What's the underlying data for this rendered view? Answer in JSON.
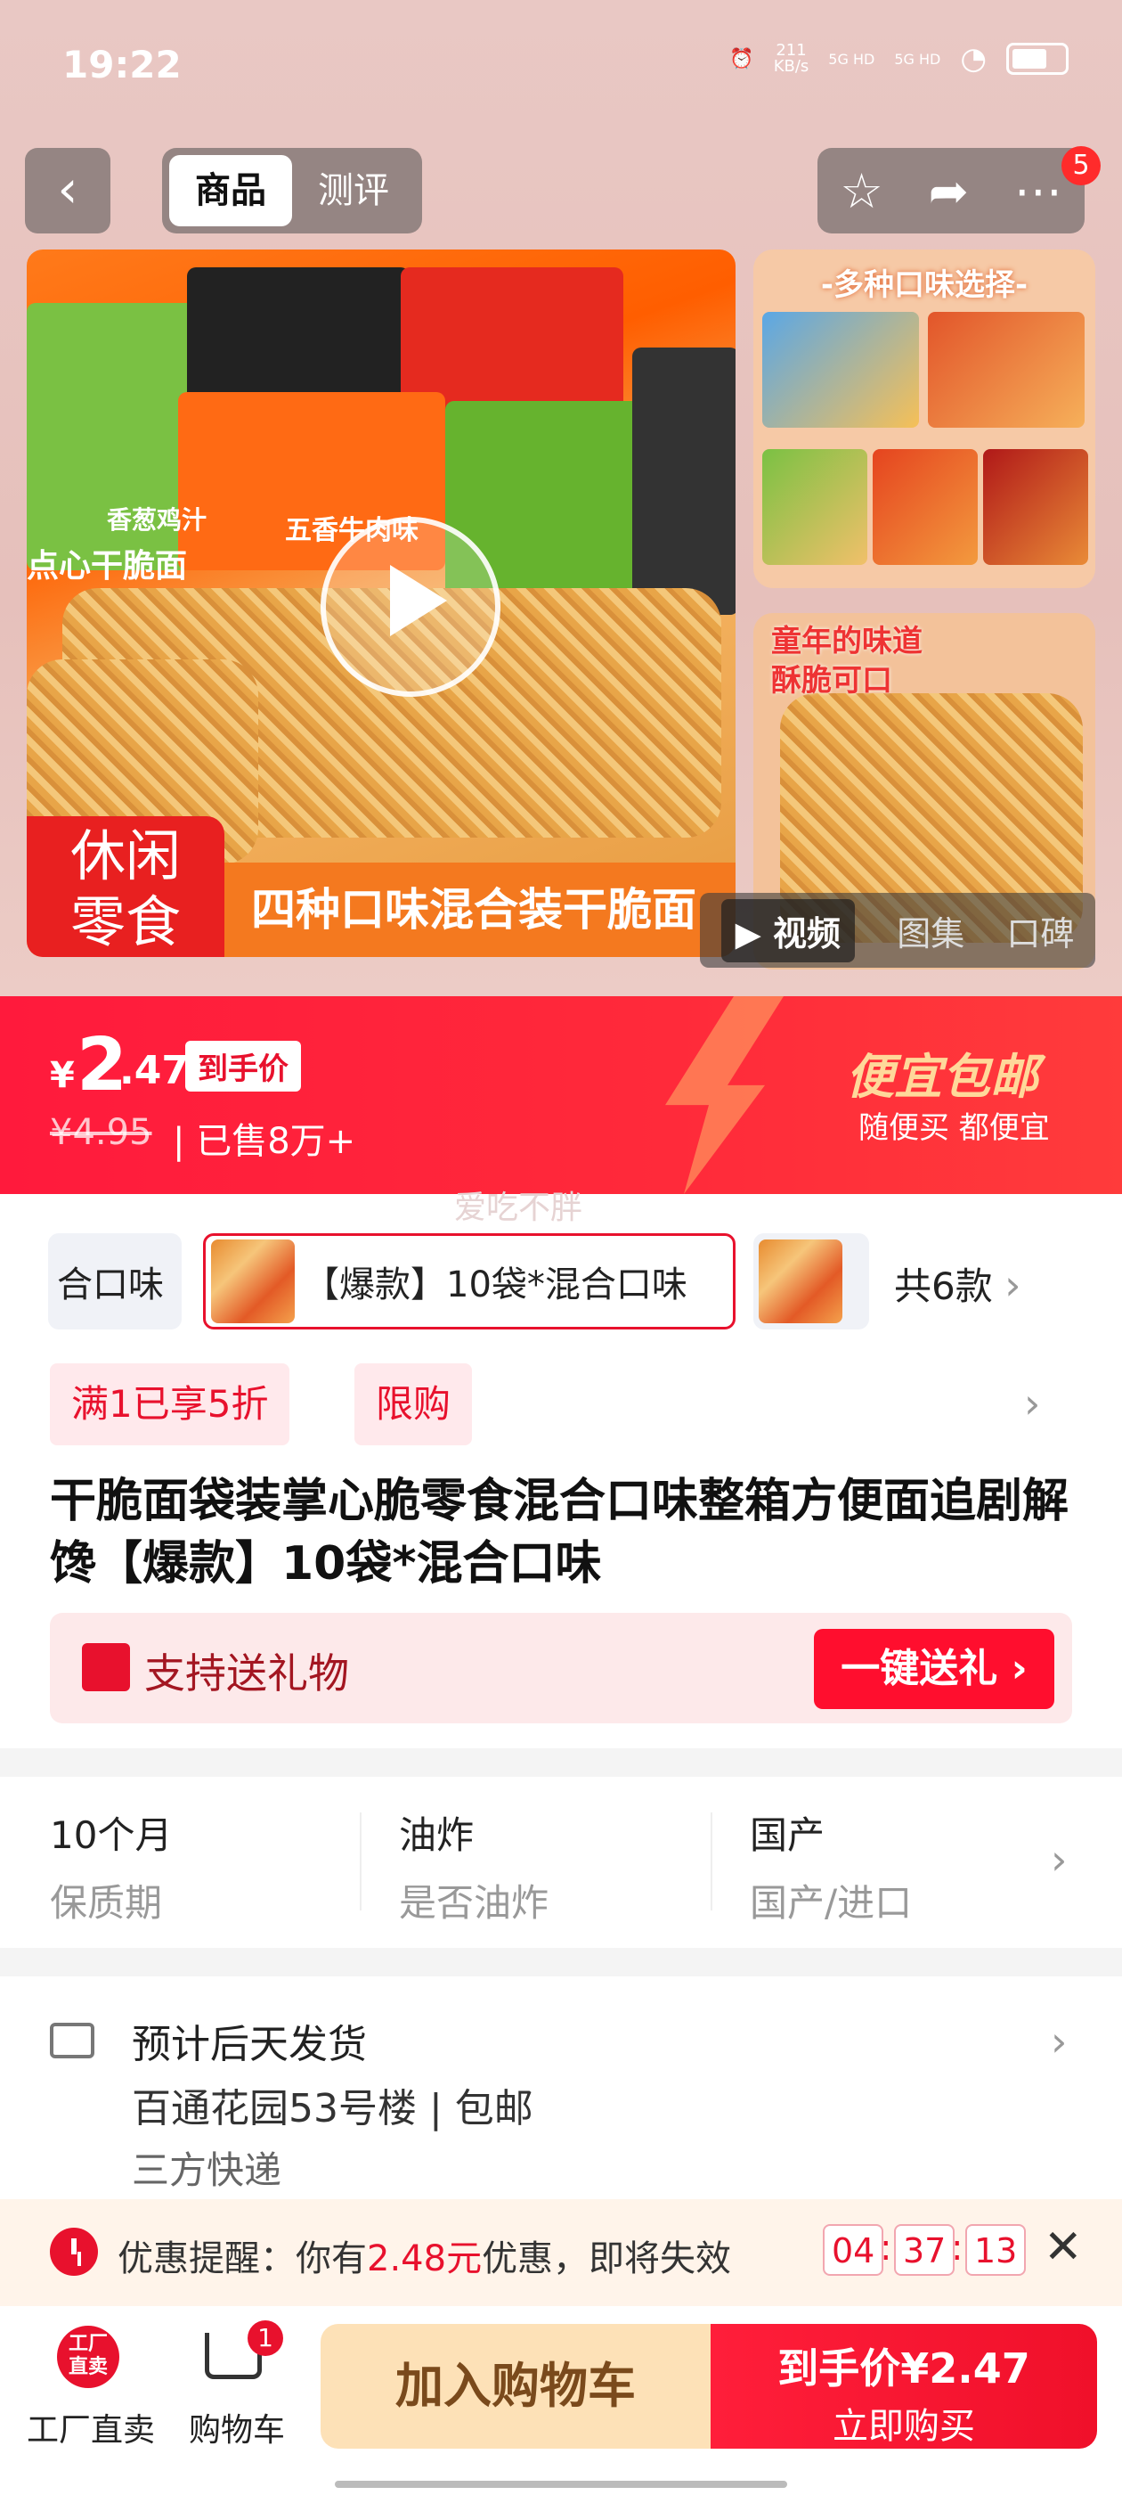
{
  "status_bar": {
    "time": "19:22",
    "net_speed": "211\nKB/s",
    "sig1": "5G HD",
    "sig2": "5G HD"
  },
  "header": {
    "tabs": [
      "商品",
      "测评"
    ],
    "more_badge": "5"
  },
  "gallery": {
    "banner_tag": "休闲\n零食",
    "banner_text": "四种口味混合装干脆面",
    "bag_labels": [
      "香葱鸡汁",
      "五香牛肉味",
      "点心干脆面"
    ],
    "thumb1_title": "-多种口味选择-",
    "thumb2_title": "童年的味道\n酥脆可口",
    "media_tabs": [
      "▶ 视频",
      "图集",
      "口碑"
    ]
  },
  "price": {
    "currency": "¥",
    "integer": "2",
    "decimal": ".47",
    "tag": "到手价",
    "original": "¥4.95",
    "sold": "| 已售8万+",
    "promo_title": "便宜包邮",
    "promo_sub": "随便买 都便宜",
    "shop_name": "爱吃不胖"
  },
  "sku": {
    "prev_label": "合口味",
    "active_label": "【爆款】10袋*混合口味",
    "count": "共6款"
  },
  "tags": [
    "满1已享5折",
    "限购"
  ],
  "product_title": "干脆面袋装掌心脆零食混合口味整箱方便面追剧解馋【爆款】10袋*混合口味",
  "gift": {
    "text": "支持送礼物",
    "button": "一键送礼 ›"
  },
  "attributes": [
    {
      "value": "10个月",
      "key": "保质期"
    },
    {
      "value": "油炸",
      "key": "是否油炸"
    },
    {
      "value": "国产",
      "key": "国产/进口"
    }
  ],
  "delivery": {
    "line1": "预计后天发货",
    "line2": "百通花园53号楼 | 包邮",
    "line3": "三方快递"
  },
  "reminder": {
    "prefix": "优惠提醒：你有",
    "amount": "2.48元",
    "suffix": "优惠，即将失效",
    "timer": [
      "04",
      "37",
      "13"
    ]
  },
  "bottom": {
    "factory_icon": "工厂\n直卖",
    "factory_label": "工厂直卖",
    "cart_badge": "1",
    "cart_label": "购物车",
    "add_cart": "加入购物车",
    "buy_line1": "到手价¥2.47",
    "buy_line2": "立即购买"
  },
  "colors": {
    "brand_red": "#e8112d",
    "promo_gold": "#ffd89a",
    "add_cart_bg": "#fde1b7"
  }
}
